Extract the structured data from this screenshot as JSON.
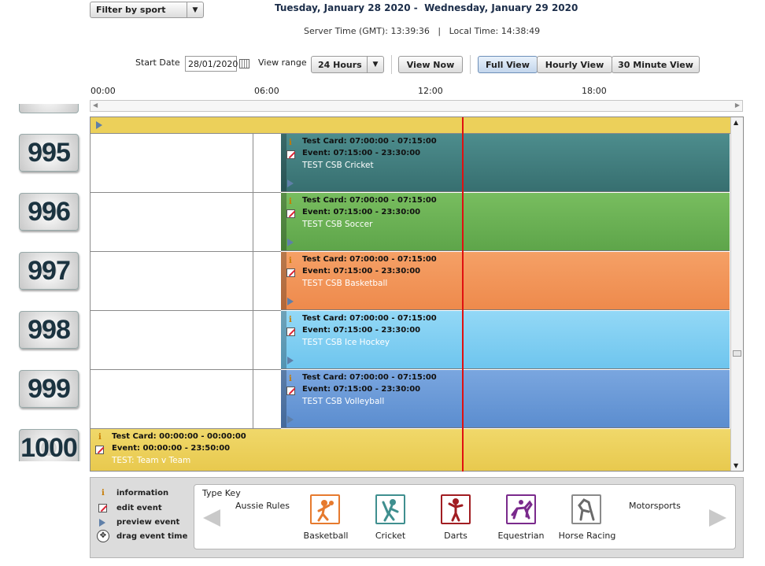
{
  "toolbar": {
    "filter_label": "Filter by sport",
    "date_range": "Tuesday, January 28 2020 -  Wednesday, January 29 2020",
    "server_time": "Server Time (GMT): 13:39:36   |   Local Time: 14:38:49",
    "start_date_label": "Start Date",
    "start_date_value": "28/01/2020",
    "view_range_label": "View range",
    "view_range_value": "24 Hours",
    "view_now_label": "View Now",
    "full_view_label": "Full View",
    "hourly_view_label": "Hourly View",
    "thirty_min_label": "30 Minute View"
  },
  "timeline": {
    "labels": [
      "00:00",
      "06:00",
      "12:00",
      "18:00"
    ]
  },
  "channels": [
    {
      "number": "995",
      "color": "#3f7f7f",
      "card": "Test Card: 07:00:00 - 07:15:00",
      "event": "Event: 07:15:00 - 23:30:00",
      "title": "TEST CSB Cricket"
    },
    {
      "number": "996",
      "color": "#6db356",
      "card": "Test Card: 07:00:00 - 07:15:00",
      "event": "Event: 07:15:00 - 23:30:00",
      "title": "TEST CSB Soccer"
    },
    {
      "number": "997",
      "color": "#f1955a",
      "card": "Test Card: 07:00:00 - 07:15:00",
      "event": "Event: 07:15:00 - 23:30:00",
      "title": "TEST CSB Basketball"
    },
    {
      "number": "998",
      "color": "#7fcdf0",
      "card": "Test Card: 07:00:00 - 07:15:00",
      "event": "Event: 07:15:00 - 23:30:00",
      "title": "TEST CSB Ice Hockey"
    },
    {
      "number": "999",
      "color": "#6b9ad6",
      "card": "Test Card: 07:00:00 - 07:15:00",
      "event": "Event: 07:15:00 - 23:30:00",
      "title": "TEST CSB Volleyball"
    },
    {
      "number": "1000",
      "color": "#ecd05a",
      "card": "Test Card: 00:00:00 - 00:00:00",
      "event": "Event: 00:00:00 - 23:50:00",
      "title": "TEST: Team v Team"
    }
  ],
  "legend": {
    "information": "information",
    "edit_event": "edit event",
    "preview_event": "preview event",
    "drag_event_time": "drag event time"
  },
  "type_key": {
    "title": "Type Key",
    "aussie_rules": "Aussie Rules",
    "motorsports": "Motorsports",
    "items": [
      {
        "label": "Basketball",
        "color": "#e67a2e",
        "icon": "basketball-icon"
      },
      {
        "label": "Cricket",
        "color": "#3f8f8f",
        "icon": "cricket-icon"
      },
      {
        "label": "Darts",
        "color": "#a11d22",
        "icon": "darts-icon"
      },
      {
        "label": "Equestrian",
        "color": "#7a2a8c",
        "icon": "equestrian-icon"
      },
      {
        "label": "Horse Racing",
        "color": "#8a8a8a",
        "icon": "horse-racing-icon"
      }
    ]
  }
}
